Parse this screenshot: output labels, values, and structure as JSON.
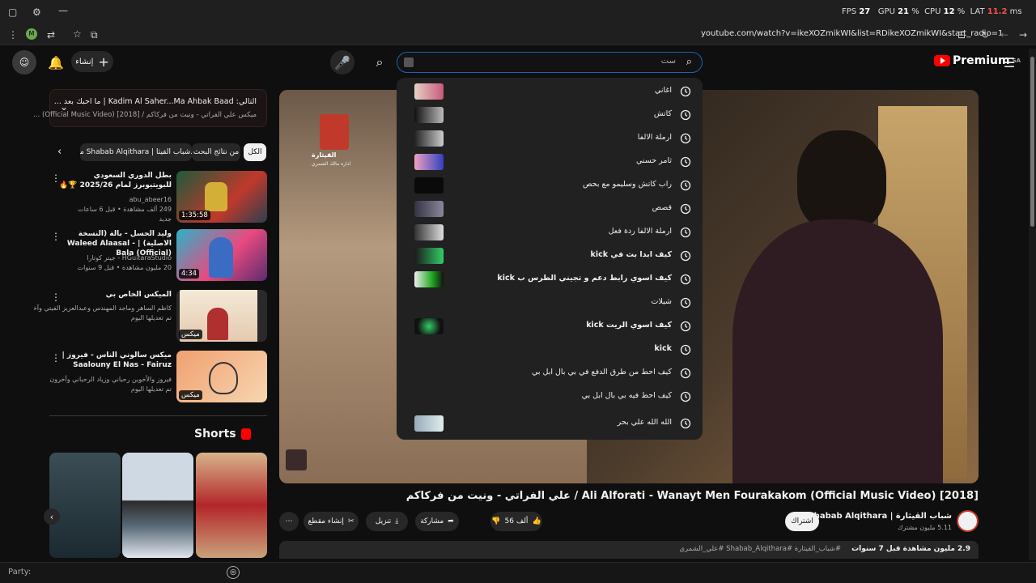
{
  "browser": {
    "url": "youtube.com/watch?v=ikeXOZmikWI&list=RDikeXOZmikWI&start_radio=1",
    "perf": {
      "fps_label": "FPS",
      "fps": "27",
      "gpu_label": "GPU",
      "gpu": "21",
      "pct1": "%",
      "cpu_label": "CPU",
      "cpu": "12",
      "pct2": "%",
      "lat_label": "LAT",
      "lat": "11.2",
      "ms": "ms"
    },
    "status_label": "Party:"
  },
  "header": {
    "create_label": "إنشاء",
    "search_value": "ست",
    "premium_label": "Premium",
    "premium_region": "SA"
  },
  "search_suggestions": [
    {
      "text": "اغاني"
    },
    {
      "text": "كاتش"
    },
    {
      "text": "ارملة الالفا"
    },
    {
      "text": "ثامر حسني"
    },
    {
      "text": "راب كاتش وسليمو مع بحص"
    },
    {
      "text": "قصص"
    },
    {
      "text": "ارملة الالفا ردة فعل"
    },
    {
      "text": "كيف ابدا بث في kick"
    },
    {
      "text": "كيف اسوي رابط دعم و تجيني الطرس ب kick"
    },
    {
      "text": "شيلات"
    },
    {
      "text": "كيف اسوي الريت kick"
    },
    {
      "text": "kick"
    },
    {
      "text": "كيف احط من طرق الدفع في بي بال ابل بي"
    },
    {
      "text": "كيف احط فيه بي بال ابل بي"
    },
    {
      "text": "الله الله علي بحر"
    }
  ],
  "up_next": {
    "line1": "التالي: Kadim Al Saher...Ma Ahbak Baad | ما احبك بعد ...",
    "line2": "ميكس علي الفراتي - ونيت من فركاكم / Official Music Video) [2018]) ..."
  },
  "chips": [
    {
      "label": "الكل"
    },
    {
      "label": "من نتائج البحث"
    },
    {
      "label": "من Shabab Alqithara | شباب القيثا..."
    }
  ],
  "related": [
    {
      "title": "بطل الدوري السعودي للبويتيوبرز لمام 2025/26 🏆🔥",
      "channel": "abu_abeer16",
      "meta": "249 ألف مشاهدة • قبل 6 ساعات",
      "badge": "جديد",
      "duration": "1:35:58"
    },
    {
      "title": "وليد الحسل - بالة (النسخة الاصلية) | Waleed Alaasal - Bala (Official)",
      "channel": "HGuitaraStudio - جيتر كوتارا",
      "meta": "20 مليون مشاهدة • قبل 9 سنوات",
      "badge": "",
      "duration": "4:34"
    },
    {
      "title": "الميكس الخاص بي",
      "channel": "كاظم الساهر وماجد المهندس وعبدالعزيز الفيتي وآخرون",
      "meta": "تم تعديلها اليوم",
      "badge": "",
      "duration": "ميكس"
    },
    {
      "title": "ميكس سالوني الناس - فيروز | Saalouny El Nas - Fairuz",
      "channel": "فيروز والأخوين رحباني وزياد الرحباني وآخرون",
      "meta": "تم تعديلها اليوم",
      "badge": "",
      "duration": "ميكس"
    }
  ],
  "shorts_label": "Shorts",
  "video": {
    "title": "علي الفراتي - ونيت من فركاكم / Ali Alforati - Wanayt Men Fourakakom (Official Music Video) [2018]",
    "channel": "شباب القيثارة | Shabab Alqithara",
    "subs": "5.11 مليون مشترك",
    "join_label": "اشتراك",
    "likes": "56 ألف",
    "share_label": "مشاركة",
    "download_label": "تنزيل",
    "clip_label": "إنشاء مقطع",
    "views": "2.9 مليون مشاهدة قبل 7 سنوات",
    "hashtags": "#شباب_القيثارة #Shabab_Alqithara #علي_الشمري",
    "logo_text": "القيثارة",
    "logo_sub": "اداره مالك الشمري"
  },
  "colors": {
    "bg": "#0f0f0f",
    "accent": "#ff0000",
    "focus": "#1c62b9"
  }
}
